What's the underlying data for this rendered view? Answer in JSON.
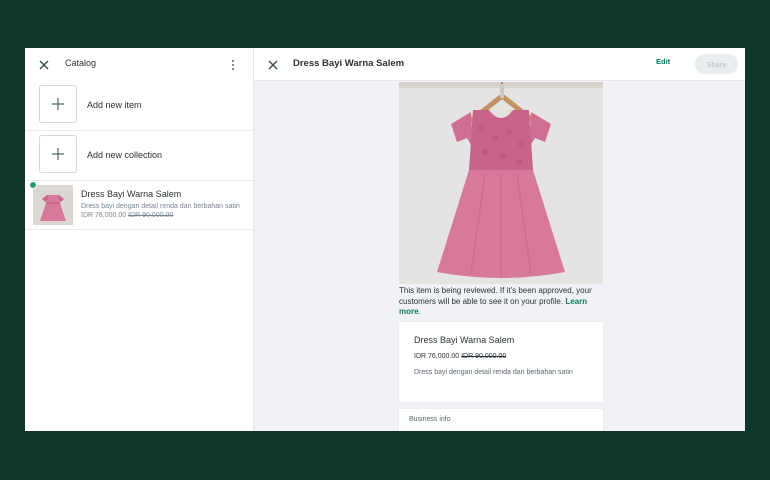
{
  "left": {
    "title": "Catalog",
    "add_item_label": "Add new item",
    "add_collection_label": "Add new collection",
    "products": [
      {
        "name": "Dress Bayi Warna Salem",
        "description": "Dress bayi dengan detail renda dan berbahan satin",
        "price": "IDR 76,000.00",
        "old_price": "IDR 90,000.00"
      }
    ]
  },
  "detail": {
    "title": "Dress Bayi Warna Salem",
    "edit_label": "Edit",
    "share_label": "Share",
    "review_text": "This item is being reviewed. If it's been approved, your customers will be able to see it on your profile. ",
    "learn_more": "Learn more",
    "review_end": ".",
    "card": {
      "name": "Dress Bayi Warna Salem",
      "price": "IDR 76,000.00",
      "old_price": "IDR 90,000.00",
      "description": "Dress bayi dengan detail renda dan berbahan satin"
    },
    "business_info_label": "Business info"
  },
  "colors": {
    "background": "#0f3727",
    "accent": "#00806a",
    "dress": "#d6799a",
    "badge": "#25a06a"
  },
  "icons": [
    "close-icon",
    "kebab-menu-icon",
    "plus-icon",
    "check-badge-icon"
  ]
}
